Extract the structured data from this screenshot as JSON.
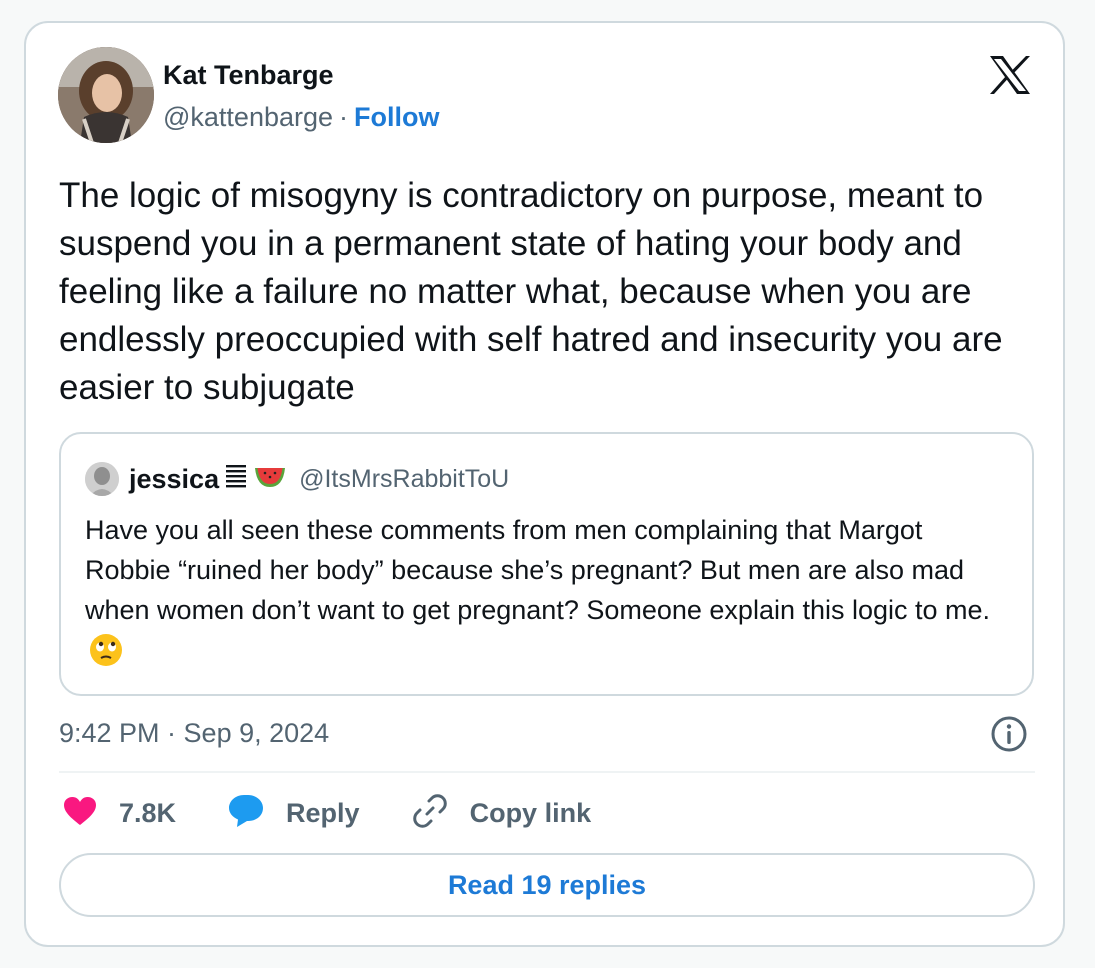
{
  "author": {
    "name": "Kat Tenbarge",
    "handle": "@kattenbarge",
    "separator": "·",
    "follow_label": "Follow"
  },
  "tweet": {
    "text": "The logic of misogyny is contradictory on purpose, meant to suspend you in a permanent state of hating your body and feeling like a failure no matter what, because when you are endlessly preoccupied with self hatred and insecurity you are easier to subjugate",
    "timestamp": "9:42 PM · Sep 9, 2024"
  },
  "quoted_tweet": {
    "name": "jessica",
    "name_emojis": [
      "stack-icon",
      "watermelon-icon"
    ],
    "handle": "@ItsMrsRabbitToU",
    "text": "Have you all seen these comments from men complaining that Margot Robbie “ruined her body” because she’s pregnant? But men are also mad when women don’t want to get pregnant? Someone explain this logic to me.",
    "trailing_emoji": "eye-roll-face-icon"
  },
  "actions": {
    "like_count": "7.8K",
    "reply_label": "Reply",
    "copy_link_label": "Copy link"
  },
  "read_replies_label": "Read 19 replies",
  "colors": {
    "link_blue": "#1d7ad6",
    "like_pink": "#f91880",
    "reply_blue": "#1d9bf0",
    "secondary_text": "#536471",
    "border": "#cfd9de"
  }
}
